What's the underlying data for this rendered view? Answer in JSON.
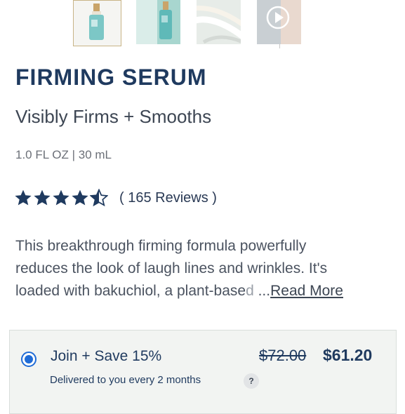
{
  "gallery": {
    "thumbnails": [
      {
        "name": "product-bottle-front",
        "selected": true
      },
      {
        "name": "product-bottle-teal"
      },
      {
        "name": "serum-texture"
      },
      {
        "name": "video",
        "icon": "play-icon"
      }
    ]
  },
  "product": {
    "title": "FIRMING SERUM",
    "subtitle": "Visibly Firms + Smooths",
    "size": "1.0 FL OZ | 30 mL",
    "rating": 4.5,
    "reviews_label": "( 165 Reviews )",
    "description_lines": [
      "This breakthrough firming formula powerfully",
      "reduces the look of laugh lines and wrinkles. It's"
    ],
    "description_last": "loaded with bakuchiol, a plant-base",
    "description_fade": "d",
    "ellipsis": " ...",
    "read_more": "Read More"
  },
  "subscription": {
    "label": "Join + Save 15%",
    "old_price": "$72.00",
    "new_price": "$61.20",
    "delivery": "Delivered to you every 2 months",
    "help": "?"
  },
  "colors": {
    "brand_navy": "#1f3a5f",
    "radio_blue": "#1f6bd6",
    "star": "#1f3a5f"
  }
}
